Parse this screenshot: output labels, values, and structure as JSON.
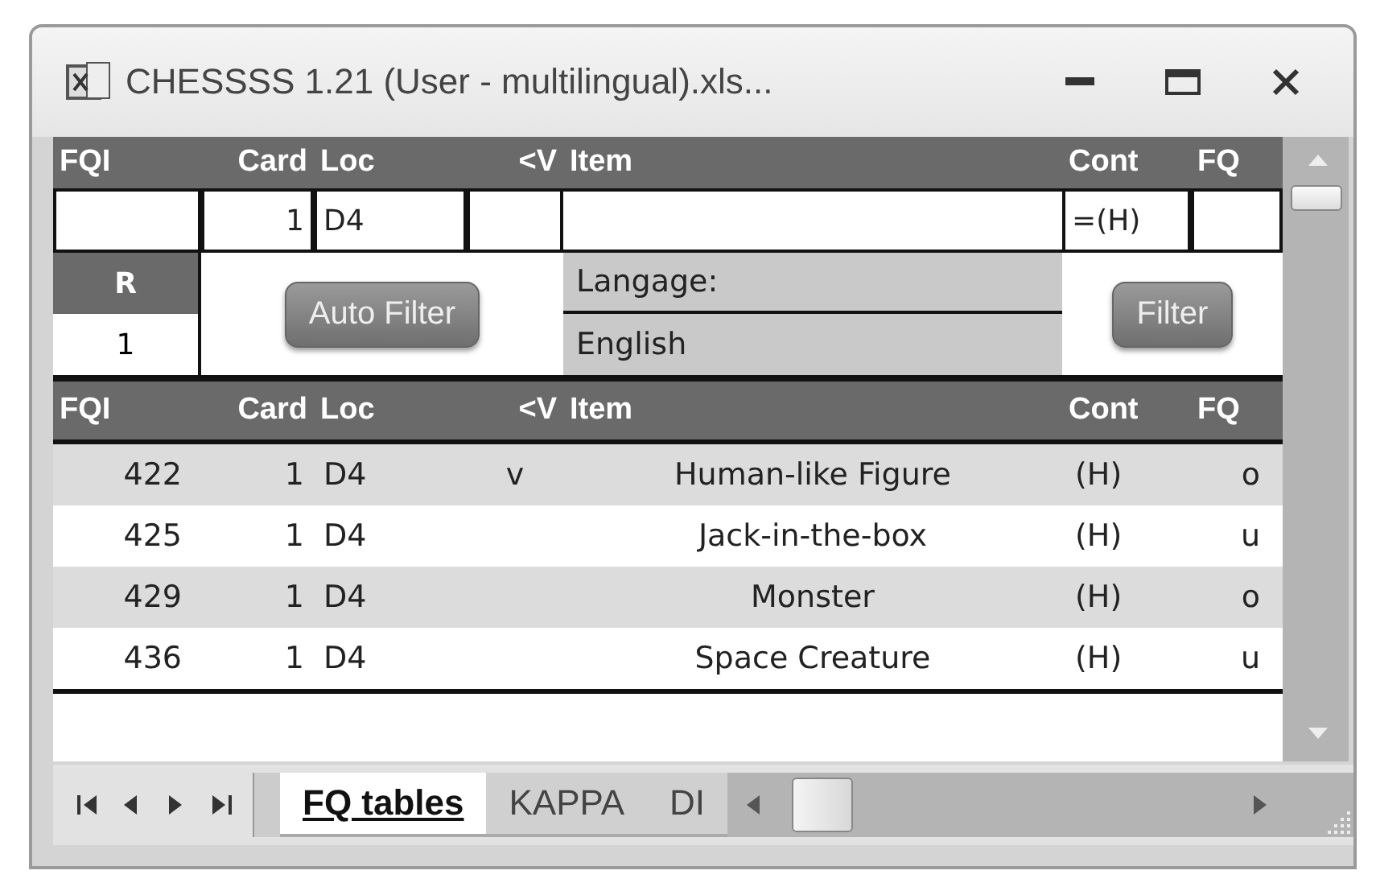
{
  "window": {
    "title": "CHESSSS 1.21 (User - multilingual).xls..."
  },
  "top_columns": [
    "FQI",
    "Card",
    "Loc",
    "<V",
    "Item",
    "Cont",
    "FQ"
  ],
  "filter_row": {
    "card": "1",
    "loc": "D4",
    "cont": "=(H)"
  },
  "panel": {
    "r_label": "R",
    "r_value": "1",
    "auto_filter_button": "Auto Filter",
    "language_label": "Langage:",
    "language_value": "English",
    "filter_button": "Filter"
  },
  "table": {
    "columns": [
      "FQI",
      "Card",
      "Loc",
      "<V",
      "Item",
      "Cont",
      "FQ"
    ],
    "rows": [
      {
        "fqi": "422",
        "card": "1",
        "loc": "D4",
        "v": "v",
        "item": "Human-like Figure",
        "cont": "(H)",
        "fq": "o"
      },
      {
        "fqi": "425",
        "card": "1",
        "loc": "D4",
        "item": "Jack-in-the-box",
        "cont": "(H)",
        "fq": "u"
      },
      {
        "fqi": "429",
        "card": "1",
        "loc": "D4",
        "item": "Monster",
        "cont": "(H)",
        "fq": "o"
      },
      {
        "fqi": "436",
        "card": "1",
        "loc": "D4",
        "item": "Space Creature",
        "cont": "(H)",
        "fq": "u"
      }
    ]
  },
  "sheet_tabs": [
    {
      "label": "FQ tables",
      "selected": true
    },
    {
      "label": "KAPPA",
      "selected": false
    },
    {
      "label": "DI",
      "selected": false
    }
  ]
}
